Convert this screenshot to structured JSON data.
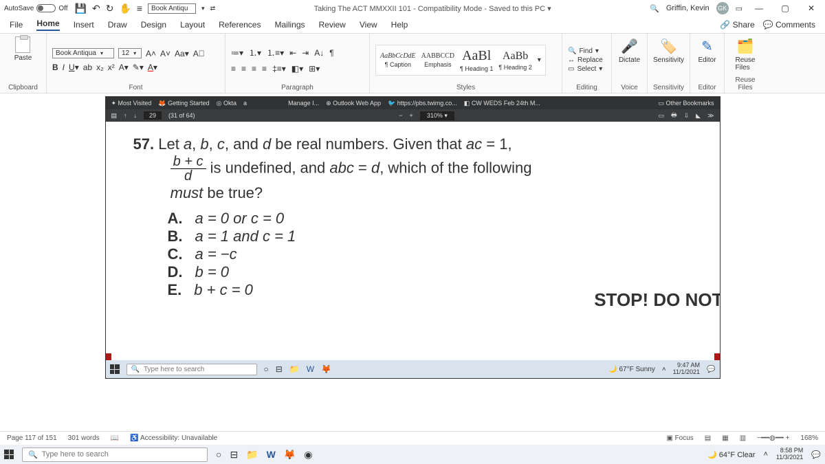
{
  "titlebar": {
    "autosave_label": "AutoSave",
    "autosave_state": "Off",
    "font_dropdown": "Book Antiqu",
    "doc_title": "Taking The ACT MMXXII 101  -  Compatibility Mode  -  Saved to this PC ▾",
    "user_name": "Griffin, Kevin",
    "user_initials": "GK"
  },
  "menu": {
    "file": "File",
    "home": "Home",
    "insert": "Insert",
    "draw": "Draw",
    "design": "Design",
    "layout": "Layout",
    "references": "References",
    "mailings": "Mailings",
    "review": "Review",
    "view": "View",
    "help": "Help",
    "share": "Share",
    "comments": "Comments"
  },
  "ribbon": {
    "clipboard": {
      "paste": "Paste",
      "label": "Clipboard"
    },
    "font": {
      "name": "Book Antiqua",
      "size": "12",
      "label": "Font"
    },
    "paragraph": {
      "label": "Paragraph"
    },
    "styles": {
      "label": "Styles",
      "items": [
        {
          "preview": "AaBbCcDdE",
          "name": "¶ Caption",
          "size": "10px",
          "style": "italic"
        },
        {
          "preview": "AABBCCD",
          "name": "Emphasis",
          "size": "10px",
          "style": "normal"
        },
        {
          "preview": "AaBl",
          "name": "¶ Heading 1",
          "size": "20px",
          "style": "normal"
        },
        {
          "preview": "AaBb",
          "name": "¶ Heading 2",
          "size": "16px",
          "style": "normal"
        }
      ]
    },
    "editing": {
      "find": "Find",
      "replace": "Replace",
      "select": "Select",
      "label": "Editing"
    },
    "dictate": "Dictate",
    "sensitivity": "Sensitivity",
    "editor": "Editor",
    "reuse": "Reuse Files",
    "voice": "Voice",
    "sens_label": "Sensitivity",
    "editor_label": "Editor",
    "reuse_label": "Reuse Files"
  },
  "inner_bookmarks": {
    "most_visited": "Most Visited",
    "getting_started": "Getting Started",
    "okta": "Okta",
    "a": "a",
    "manage": "Manage I...",
    "owa": "Outlook Web App",
    "twimg": "https://pbs.twimg.co...",
    "cw": "CW WEDS Feb 24th M...",
    "other": "Other Bookmarks"
  },
  "inner_toolbar": {
    "page_input": "29",
    "page_of": "(31 of 64)",
    "zoom": "310%"
  },
  "question": {
    "number": "57.",
    "line1_a": "Let ",
    "line1_b": ", and ",
    "line1_c": " be real numbers. Given that ",
    "line1_d": " = 1,",
    "frac_top": "b + c",
    "frac_bot": "d",
    "line2_a": " is undefined, and ",
    "line2_b": " = ",
    "line2_c": ", which of the following",
    "line3": " be true?",
    "must": "must",
    "choices": [
      {
        "k": "A.",
        "t": "a = 0 or c = 0"
      },
      {
        "k": "B.",
        "t": "a = 1 and c = 1"
      },
      {
        "k": "C.",
        "t": "a = −c"
      },
      {
        "k": "D.",
        "t": "b = 0"
      },
      {
        "k": "E.",
        "t": "b + c = 0"
      }
    ],
    "stop": "STOP! DO NOT"
  },
  "inner_taskbar": {
    "search_placeholder": "Type here to search",
    "weather": "67°F  Sunny",
    "time": "9:47 AM",
    "date": "11/1/2021"
  },
  "statusbar": {
    "page": "Page 117 of 151",
    "words": "301 words",
    "accessibility": "Accessibility: Unavailable",
    "focus": "Focus",
    "zoom": "168%"
  },
  "outer_taskbar": {
    "search_placeholder": "Type here to search",
    "weather": "64°F  Clear",
    "time": "8:58 PM",
    "date": "11/3/2021"
  }
}
